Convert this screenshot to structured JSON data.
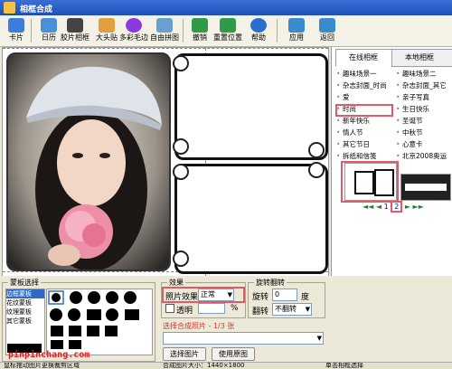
{
  "window": {
    "title": "相框合成"
  },
  "toolbar": {
    "buttons": [
      {
        "label": "卡片",
        "icon": "card-icon",
        "color": "#3b7dd8"
      },
      {
        "label": "日历",
        "icon": "calendar-icon",
        "color": "#4a90d9"
      },
      {
        "label": "胶片相框",
        "icon": "film-icon",
        "color": "#444444"
      },
      {
        "label": "大头贴",
        "icon": "sticker-icon",
        "color": "#e0a040"
      },
      {
        "label": "多彩毛边",
        "icon": "flower-icon",
        "color": "#8a3adf"
      },
      {
        "label": "自由拼图",
        "icon": "puzzle-icon",
        "color": "#6aa0d0"
      },
      {
        "label": "撤销",
        "icon": "undo-icon",
        "color": "#2e9a4a"
      },
      {
        "label": "重置位置",
        "icon": "reset-icon",
        "color": "#2e9a4a"
      },
      {
        "label": "帮助",
        "icon": "help-icon",
        "color": "#2a6fd0"
      },
      {
        "label": "应用",
        "icon": "apply-icon",
        "color": "#3a8ad0"
      },
      {
        "label": "返回",
        "icon": "back-icon",
        "color": "#3a8ad0"
      }
    ]
  },
  "right_panel": {
    "tabs": [
      "在线相框",
      "本地相框"
    ],
    "items": [
      [
        "趣味场景一",
        "趣味场景二"
      ],
      [
        "杂志封面_时尚",
        "杂志封面_其它"
      ],
      [
        "爱",
        "亲子写真"
      ],
      [
        "时尚",
        "生日快乐"
      ],
      [
        "新年快乐",
        "圣诞节"
      ],
      [
        "情人节",
        "中秋节"
      ],
      [
        "其它节日",
        "心意卡"
      ],
      [
        "拆纸和信笺",
        "北京2008奥运"
      ]
    ],
    "pager": {
      "prev_first": "◄◄",
      "prev": "◄",
      "page1": "1",
      "page2": "2",
      "next": "►",
      "next_last": "►►"
    }
  },
  "bottom": {
    "mosaic_title": "蒙板选择",
    "mosaic_list": [
      "边框蒙板",
      "花纹蒙板",
      "纹理蒙板",
      "其它蒙板"
    ],
    "watermark": "pinpinchang.com",
    "effect_title": "效果",
    "effect_label": "照片效果",
    "effect_value": "正常",
    "transparent_label": "透明",
    "percent": "%",
    "rotate_title": "旋转翻转",
    "rotate_label": "旋转",
    "rotate_value": "0",
    "rotate_unit": "度",
    "flip_label": "翻转",
    "flip_value": "不翻转",
    "select_title": "选择合成照片 - 1/3 张",
    "select_button": "选择图片",
    "original_button": "使用原图"
  },
  "status": {
    "left": "鼠标拖动图片更换裁剪区域",
    "mid": "合成图片大小：1440×1800",
    "right": "单击相框选择"
  }
}
